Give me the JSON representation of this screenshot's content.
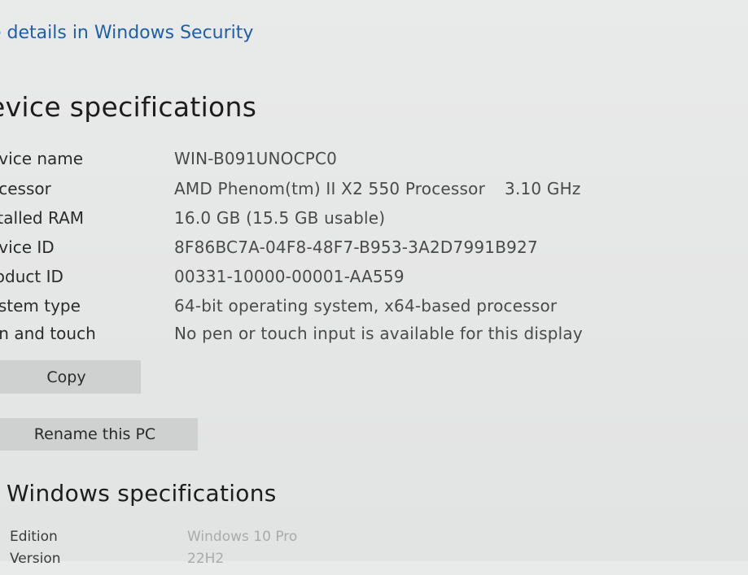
{
  "header": {
    "security_link": "e details in Windows Security"
  },
  "device_specs": {
    "title": "evice specifications",
    "rows": [
      {
        "label": "evice name",
        "value": "WIN-B091UNOCPC0",
        "extra": ""
      },
      {
        "label": "ocessor",
        "value": "AMD Phenom(tm) II X2 550 Processor",
        "extra": "3.10 GHz"
      },
      {
        "label": "stalled RAM",
        "value": "16.0 GB (15.5 GB usable)",
        "extra": ""
      },
      {
        "label": "evice ID",
        "value": "8F86BC7A-04F8-48F7-B953-3A2D7991B927",
        "extra": ""
      },
      {
        "label": "roduct ID",
        "value": "00331-10000-00001-AA559",
        "extra": ""
      },
      {
        "label": "ystem type",
        "value": "64-bit operating system, x64-based processor",
        "extra": ""
      },
      {
        "label": "en and touch",
        "value": "No pen or touch input is available for this display",
        "extra": ""
      }
    ],
    "copy_label": "Copy",
    "rename_label": "Rename this PC"
  },
  "windows_specs": {
    "title": "Windows specifications",
    "rows": [
      {
        "label": "Edition",
        "value": "Windows 10 Pro"
      },
      {
        "label": "Version",
        "value": "22H2"
      }
    ]
  }
}
